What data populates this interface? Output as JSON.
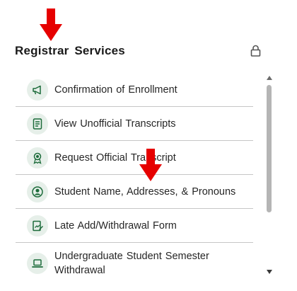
{
  "header": {
    "title": "Registrar Services"
  },
  "colors": {
    "accent_green": "#1c6b3a",
    "icon_bg": "#e6efe9",
    "annotation_red": "#e60000"
  },
  "items": [
    {
      "label": "Confirmation of Enrollment",
      "icon": "megaphone-icon"
    },
    {
      "label": "View Unofficial Transcripts",
      "icon": "document-list-icon"
    },
    {
      "label": "Request Official Transcript",
      "icon": "award-ribbon-icon"
    },
    {
      "label": "Student Name, Addresses, & Pronouns",
      "icon": "user-circle-icon"
    },
    {
      "label": "Late Add/Withdrawal Form",
      "icon": "form-edit-icon"
    },
    {
      "label": "Undergraduate Student Semester Withdrawal",
      "icon": "laptop-icon"
    }
  ]
}
